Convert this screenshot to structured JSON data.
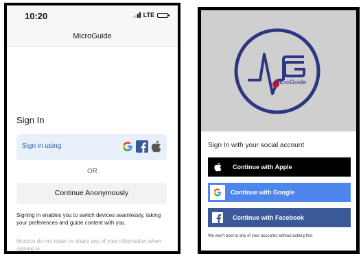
{
  "left_screen": {
    "status_bar": {
      "time": "10:20",
      "network": "LTE"
    },
    "nav_title": "MicroGuide",
    "sign_in_title": "Sign In",
    "sign_in_using_label": "Sign in using",
    "providers": [
      "google-icon",
      "facebook-icon",
      "apple-icon"
    ],
    "or_label": "OR",
    "anonymous_button_label": "Continue Anonymously",
    "info_text": "Signing in enables you to switch devices seamlessly, taking your preferences and guide content with you.",
    "disclaimer_text": "Horizon do not retain or share any of your information when signing in."
  },
  "right_screen": {
    "logo_text": "MicroGuide",
    "social_title": "Sign In with your social account",
    "buttons": [
      {
        "label": "Continue with Apple",
        "icon": "apple-icon",
        "color": "#000000"
      },
      {
        "label": "Continue with Google",
        "icon": "google-icon",
        "color": "#4f86ec"
      },
      {
        "label": "Continue with Facebook",
        "icon": "facebook-icon",
        "color": "#3b5998"
      }
    ],
    "footnote": "We won't post to any of your accounts without asking first"
  },
  "colors": {
    "brand_navy": "#2e3684",
    "sign_in_using_bg": "#e8f1fb",
    "google_red": "#ea4335",
    "facebook_blue": "#3b5998"
  }
}
